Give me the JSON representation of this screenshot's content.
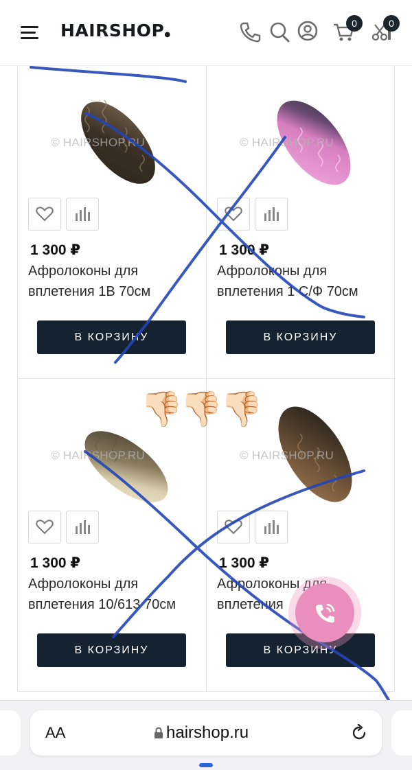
{
  "header": {
    "logo": "HAIRSHOP",
    "cart_count": "0",
    "compare_count": "0"
  },
  "products": [
    {
      "price": "1 300 ₽",
      "name": "Афролоконы для вплетения 1B 70см",
      "cart_label": "В КОРЗИНУ",
      "watermark": "© HAIRSHOP.RU",
      "colors": [
        "#2d261d",
        "#5a4a38",
        "#7d6a53"
      ]
    },
    {
      "price": "1 300 ₽",
      "name": "Афролоконы для вплетения 1 С/Ф 70см",
      "cart_label": "В КОРЗИНУ",
      "watermark": "© HAIRSHOP.RU",
      "colors": [
        "#2e3140",
        "#d77fc0",
        "#f0a9dc"
      ]
    },
    {
      "price": "1 300 ₽",
      "name": "Афролоконы для вплетения 10/613 70см",
      "cart_label": "В КОРЗИНУ",
      "watermark": "© HAIRSHOP.RU",
      "colors": [
        "#433a2c",
        "#a79a7a",
        "#efe8cf"
      ]
    },
    {
      "price": "1 300 ₽",
      "name": "Афролоконы для вплетения",
      "cart_label": "В КОРЗИНУ",
      "watermark": "© HAIRSHOP.RU",
      "colors": [
        "#1f1d1a",
        "#6a5036",
        "#9b7552"
      ]
    }
  ],
  "reaction": "👎🏻👎🏻👎🏻",
  "browser": {
    "aa": "AA",
    "url": "hairshop.ru"
  },
  "colors": {
    "button_bg": "#15222f",
    "scribble": "#2446b7",
    "call_button": "#ea8fbd"
  },
  "icons": [
    "menu-icon",
    "phone-icon",
    "search-icon",
    "user-icon",
    "cart-icon",
    "compare-icon",
    "heart-icon",
    "bar-chart-icon",
    "phone-call-icon",
    "lock-icon",
    "reload-icon"
  ]
}
